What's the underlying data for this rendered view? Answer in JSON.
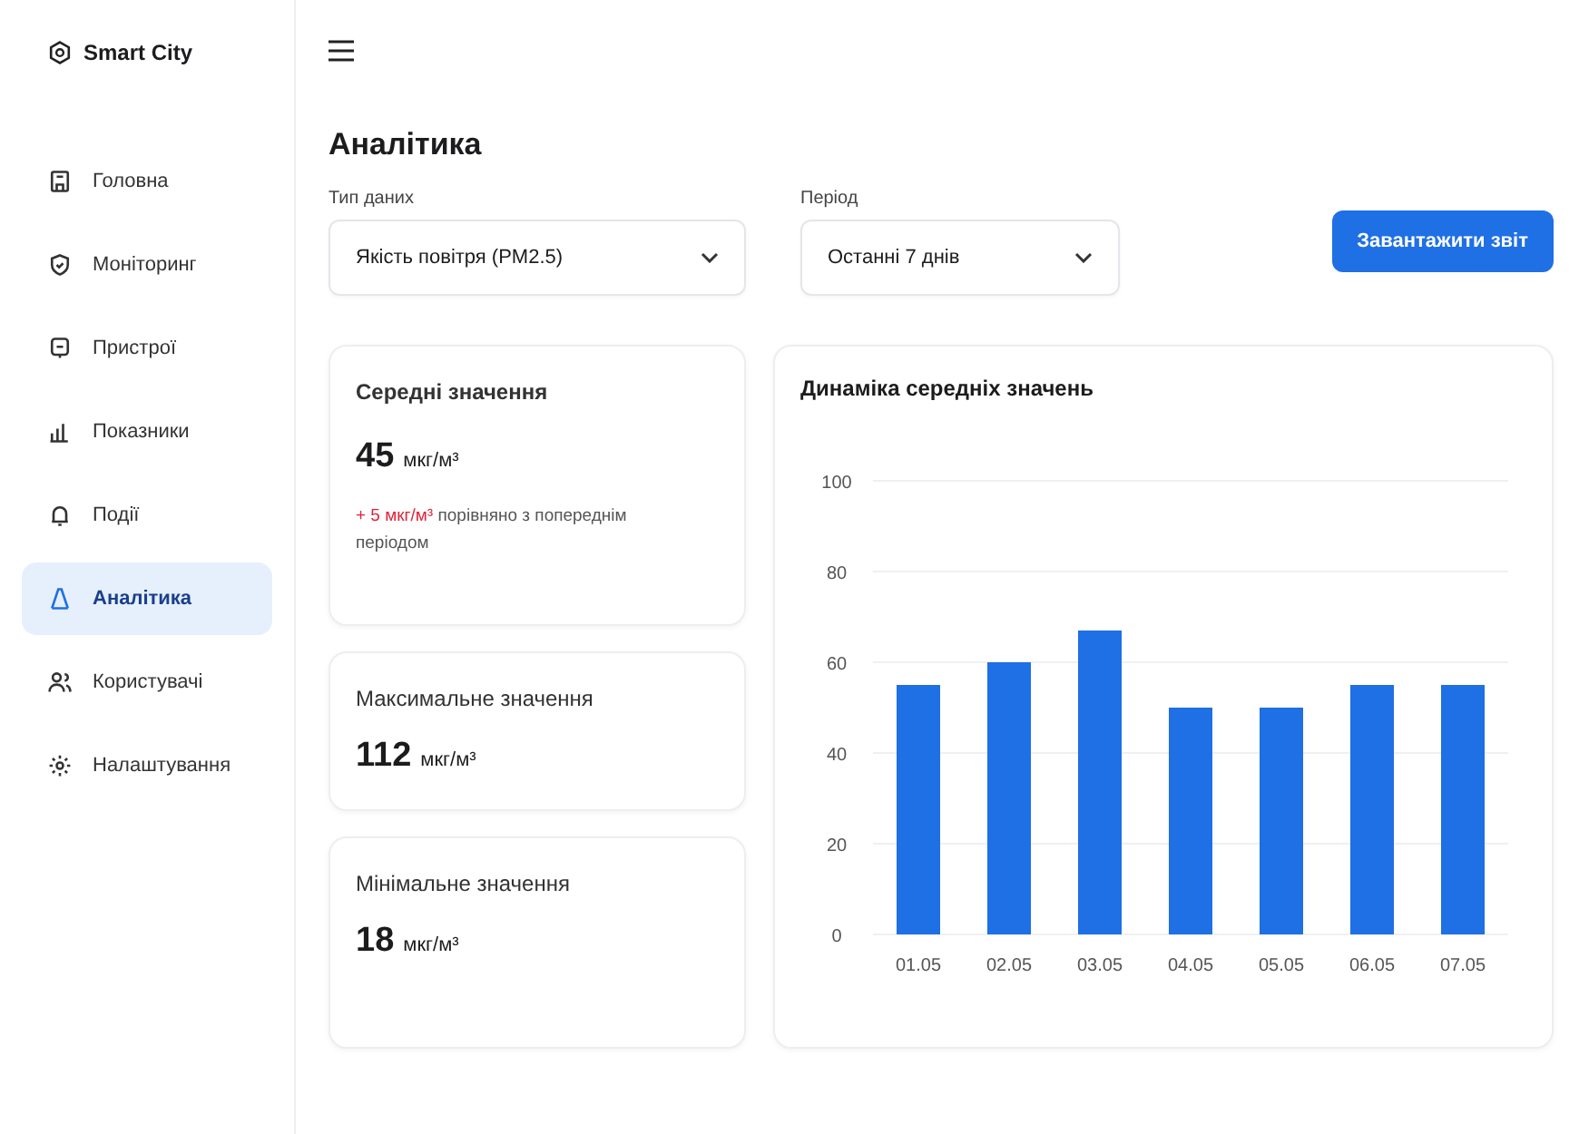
{
  "sidebar": {
    "brand": "Smart City",
    "items": [
      {
        "label": "Головна",
        "selected": false
      },
      {
        "label": "Моніторинг",
        "selected": false
      },
      {
        "label": "Пристрої",
        "selected": false
      },
      {
        "label": "Показники",
        "selected": false
      },
      {
        "label": "Події",
        "selected": false
      },
      {
        "label": "Аналітика",
        "selected": true
      },
      {
        "label": "Користувачі",
        "selected": false
      },
      {
        "label": "Налаштування",
        "selected": false
      }
    ]
  },
  "page": {
    "title": "Аналітика"
  },
  "filters": [
    {
      "label": "Тип даних",
      "value": "Якість повітря (PM2.5)"
    },
    {
      "label": "Період",
      "value": "Останні 7 днів"
    }
  ],
  "download_button": "Завантажити звіт",
  "stats": [
    {
      "title": "Середні значення",
      "value": "45",
      "unit": "мкг/м³",
      "trend": {
        "delta": "+ 5 мкг/м³",
        "text": "порівняно з попереднім періодом"
      }
    },
    {
      "title": "Максимальне значення",
      "value": "112",
      "unit": "мкг/м³"
    },
    {
      "title": "Мінімальне значення",
      "value": "18",
      "unit": "мкг/м³"
    }
  ],
  "chart": {
    "title": "Динаміка середніх значень",
    "chart_data": {
      "type": "bar",
      "categories": [
        "01.05",
        "02.05",
        "03.05",
        "04.05",
        "05.05",
        "06.05",
        "07.05"
      ],
      "values": [
        55,
        60,
        67,
        50,
        50,
        55,
        55
      ],
      "ylim": [
        0,
        100
      ],
      "yticks": [
        0,
        20,
        40,
        60,
        80,
        100
      ],
      "grid": true
    }
  }
}
